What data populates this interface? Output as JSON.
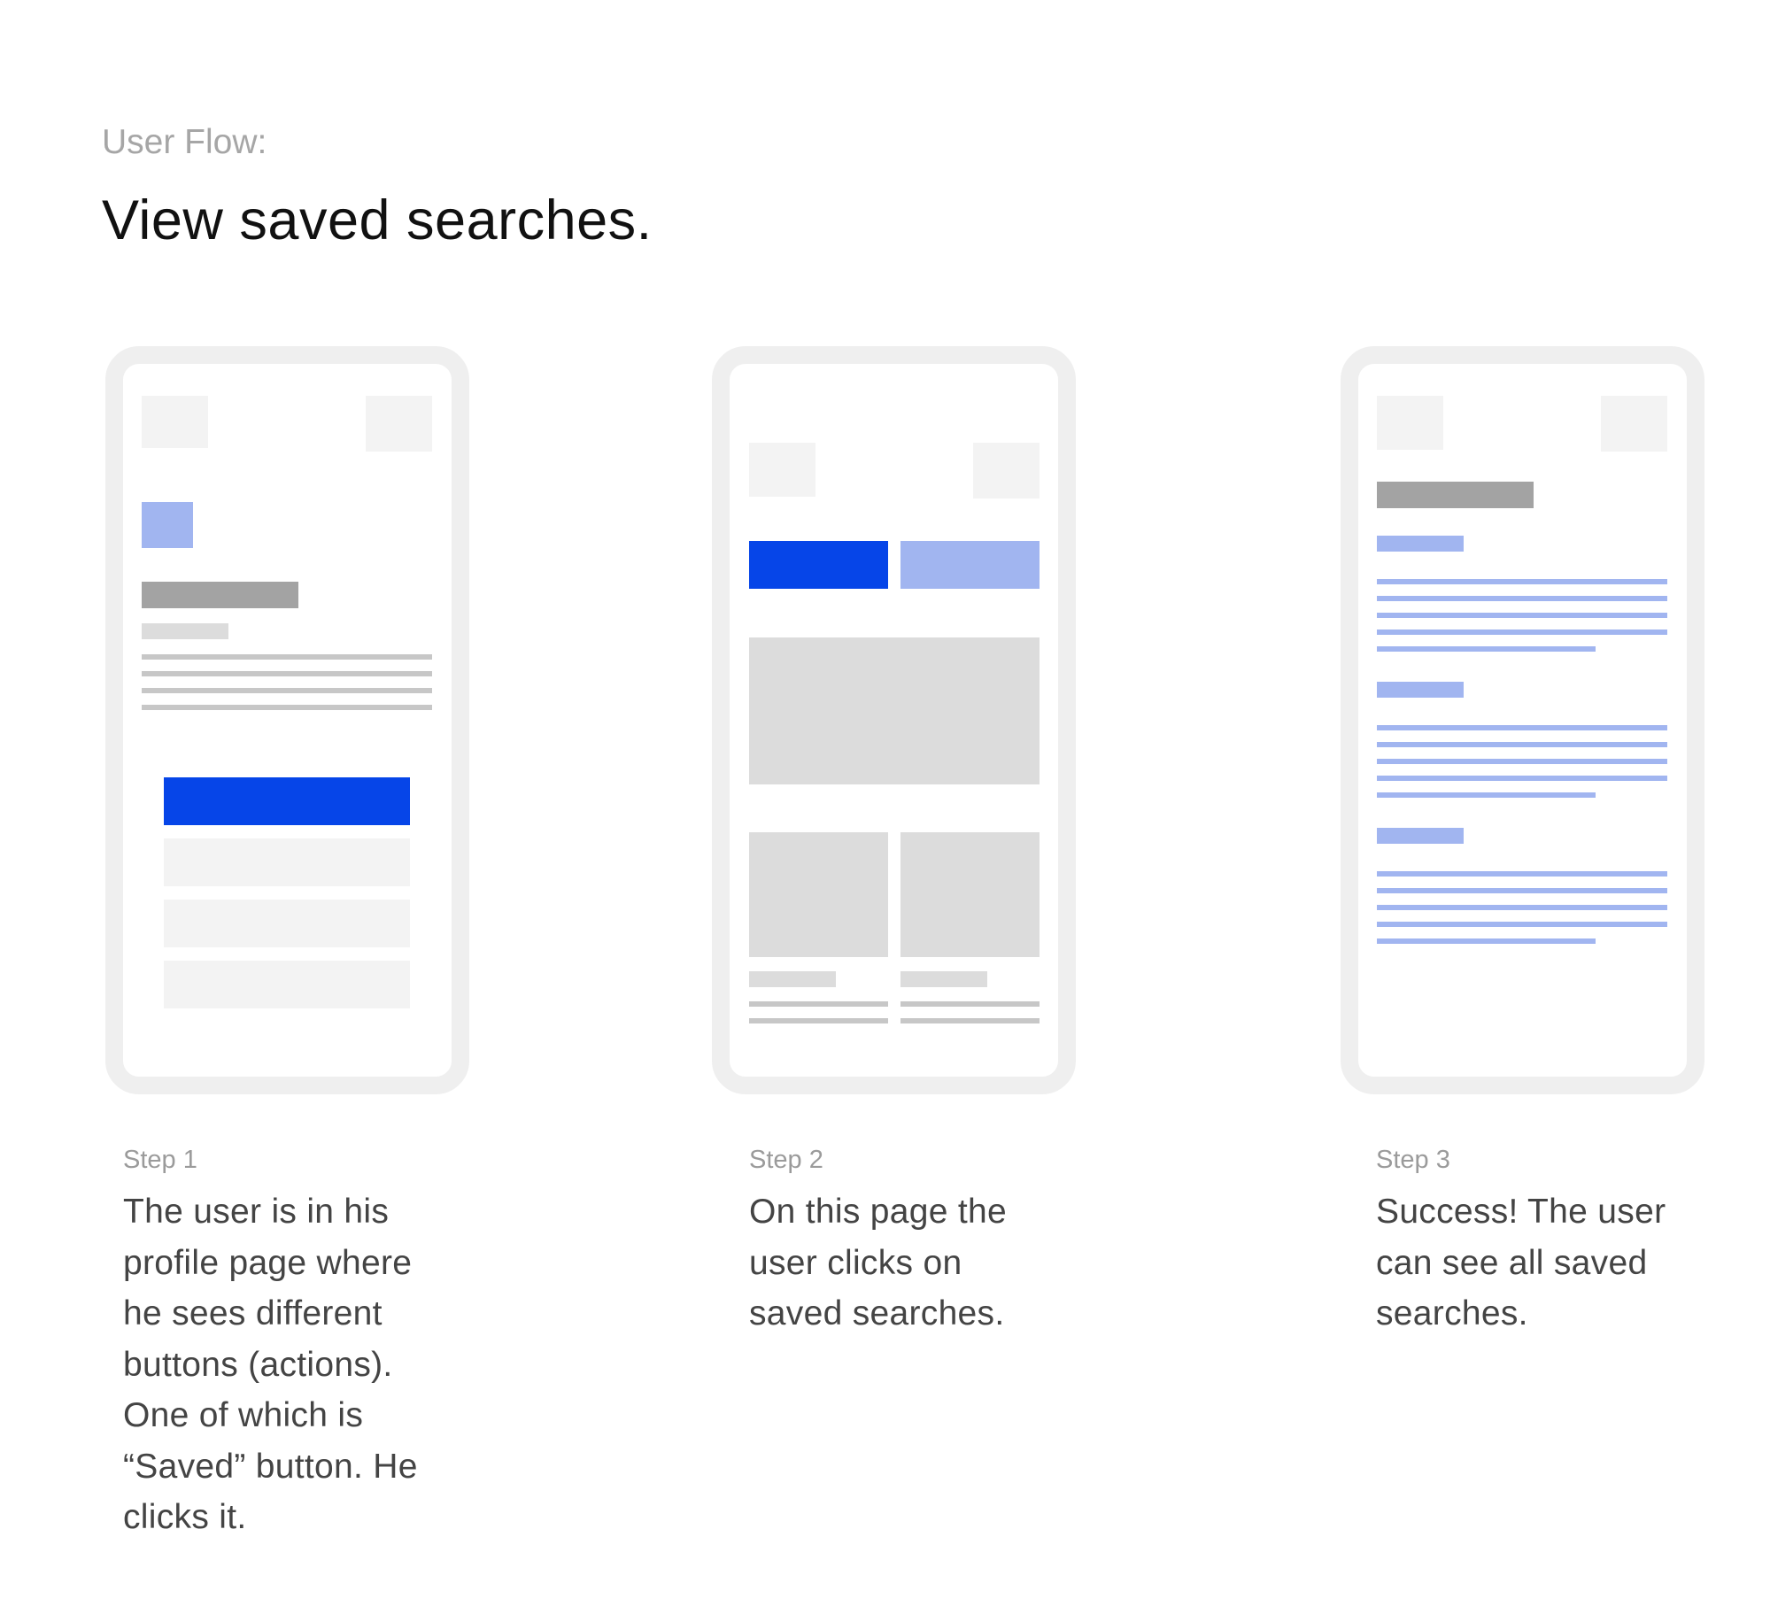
{
  "header": {
    "subtitle": "User Flow:",
    "title": "View saved searches."
  },
  "steps": [
    {
      "label": "Step 1",
      "description": "The user is in his\nprofile page where\nhe sees different\nbuttons (actions).\nOne of which is\n“Saved” button. He\nclicks it."
    },
    {
      "label": "Step 2",
      "description": "On this page the\nuser clicks on\nsaved searches."
    },
    {
      "label": "Step 3",
      "description": "Success! The user\ncan see all saved\nsearches."
    }
  ],
  "colors": {
    "primary_blue": "#0645e8",
    "soft_blue": "#a1b5f0",
    "frame_gray": "#efefef"
  }
}
